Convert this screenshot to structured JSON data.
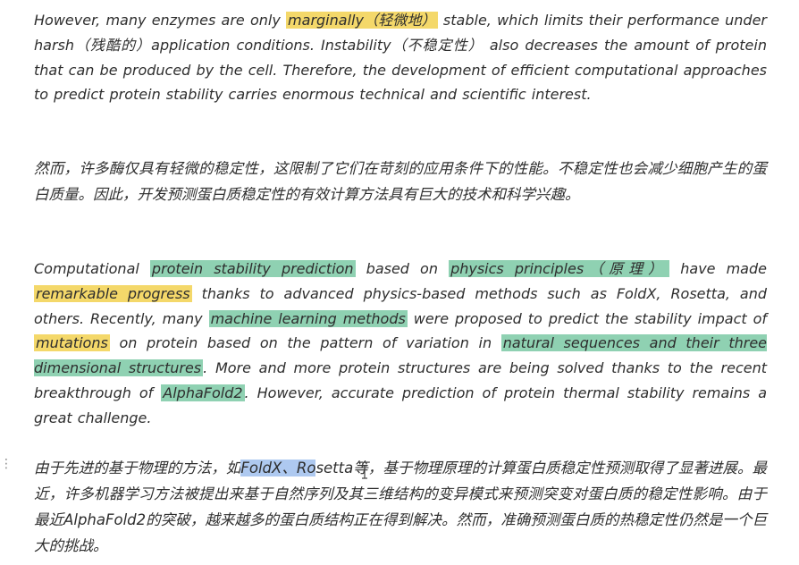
{
  "paragraph1": {
    "t1": "However, many enzymes are only ",
    "h1": "marginally（轻微地）",
    "t2": " stable, which limits their performance under harsh（残酷的）application conditions. Instability（不稳定性） also decreases the amount of protein that can be produced by the cell. Therefore, the development of efficient computational approaches to predict protein stability carries enormous technical and scientific interest."
  },
  "paragraph2": {
    "text": "然而，许多酶仅具有轻微的稳定性，这限制了它们在苛刻的应用条件下的性能。不稳定性也会减少细胞产生的蛋白质量。因此，开发预测蛋白质稳定性的有效计算方法具有巨大的技术和科学兴趣。"
  },
  "paragraph3": {
    "t1": "Computational ",
    "h1": "protein stability prediction",
    "t2": " based on ",
    "h2": "physics principles（原理）",
    "t3": " have made ",
    "h3": "remarkable progress",
    "t4": " thanks to advanced physics-based methods such as FoldX, Rosetta, and others. Recently, many ",
    "h4": "machine learning methods",
    "t5": " were proposed to predict the stability impact of ",
    "h5": "mutations",
    "t6": " on protein based on the pattern of variation in ",
    "h6": "natural sequences and their three dimensional structures",
    "t7": ". More and more protein structures are being solved thanks to the recent breakthrough of ",
    "h7": "AlphaFold2",
    "t8": ". However, accurate prediction of protein thermal stability remains a great challenge."
  },
  "paragraph4": {
    "t1": "由于先进的基于物理的方法，如",
    "sel": "FoldX、Ro",
    "t2": "setta等，基于物理原理的计算蛋白质稳定性预测取得了显著进展。最近，许多机器学习方法被提出来基于自然序列及其三维结构的变异模式来预测突变对蛋白质的稳定性影响。由于最近AlphaFold2的突破，越来越多的蛋白质结构正在得到解决。然而，准确预测蛋白质的热稳定性仍然是一个巨大的挑战。"
  },
  "side_marker": "⋮",
  "colors": {
    "highlight_yellow": "#f4d86a",
    "highlight_green": "#8fd1b2",
    "selection_blue": "#aec9f0",
    "text": "#2e2e2e"
  },
  "icons": {
    "cursor": "text-cursor-icon",
    "margin": "drag-handle-icon"
  }
}
